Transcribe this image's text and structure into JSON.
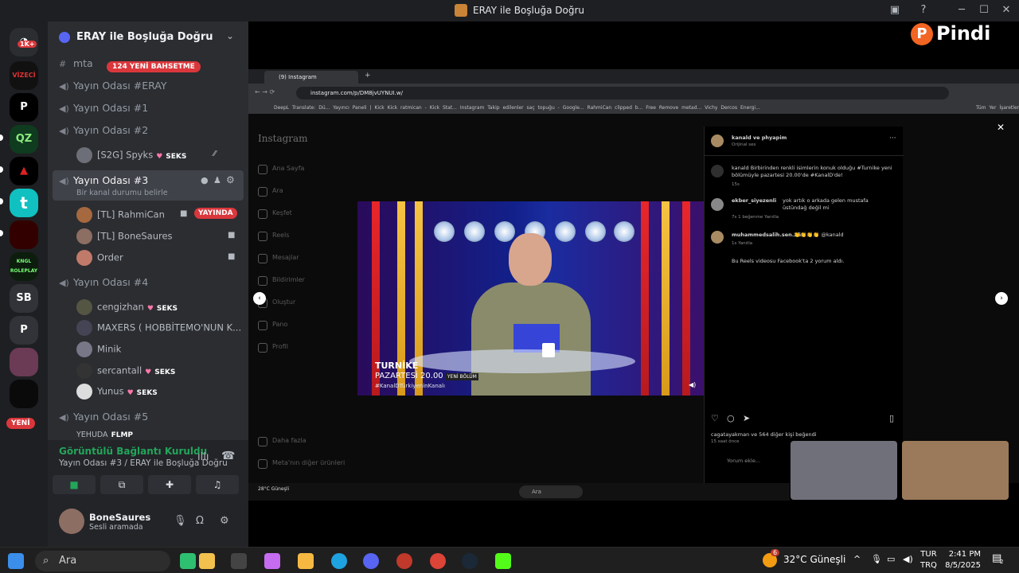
{
  "window": {
    "title": "ERAY ile Boşluğa Doğru",
    "minimize": "─",
    "maximize": "☐",
    "close": "✕"
  },
  "servers": [
    {
      "label": "",
      "badge": "1K+"
    },
    {
      "label": "VİZECİ"
    },
    {
      "label": "P"
    },
    {
      "label": "QZ"
    },
    {
      "label": "▲"
    },
    {
      "label": "t"
    },
    {
      "label": ""
    },
    {
      "label": "KNGL ROLEPLAY"
    },
    {
      "label": "SB"
    },
    {
      "label": "P"
    },
    {
      "label": ""
    },
    {
      "label": ""
    },
    {
      "label": "",
      "badge": "YENİ"
    }
  ],
  "guild": {
    "name": "ERAY ile Boşluğa Doğru",
    "chevron": "⌄"
  },
  "channels": {
    "mta": "mta",
    "mention_badge": "124 YENİ BAHSETME",
    "rooms": [
      {
        "name": "Yayın Odası #ERAY"
      },
      {
        "name": "Yayın Odası #1"
      },
      {
        "name": "Yayın Odası #2",
        "users": [
          {
            "name": "[S2G] Spyks",
            "tag": "SEKS"
          }
        ]
      },
      {
        "name": "Yayın Odası #3",
        "status": "Bir kanal durumu belirle",
        "users": [
          {
            "name": "[TL] RahmiCan",
            "live": "YAYINDA"
          },
          {
            "name": "[TL] BoneSaures"
          },
          {
            "name": "Order"
          }
        ]
      },
      {
        "name": "Yayın Odası #4",
        "users": [
          {
            "name": "cengizhan",
            "tag": "SEKS"
          },
          {
            "name": "MAXERS ( HOBBİTEMO'NUN K..."
          },
          {
            "name": "Minik"
          },
          {
            "name": "sercantall",
            "tag": "SEKS"
          },
          {
            "name": "Yunus",
            "tag": "SEKS"
          }
        ]
      },
      {
        "name": "Yayın Odası #5",
        "users": [
          {
            "name": "YEHUDA",
            "tag": "FLMP"
          }
        ]
      }
    ]
  },
  "voice_panel": {
    "status": "Görüntülü Bağlantı Kuruldu",
    "location": "Yayın Odası #3 / ERAY ile Boşluğa Doğru"
  },
  "user_panel": {
    "name": "BoneSaures",
    "status": "Sesli aramada"
  },
  "stream_overlay": {
    "brand": "Pindi",
    "brand_logo": "P"
  },
  "browser": {
    "tab": "(9) Instagram",
    "url": "instagram.com/p/DM8jvUYNUI.w/",
    "bookmarks": "DeepL Translate: Dü...   Yayıncı Paneli | Kick   Kick   ratmican - Kick Stat...   Instagram   Takip edilenler   saç topuğu - Google...   RahmiCan clipped b...   Free Remove metad...   Vichy Dercos Energi...",
    "all_bookmarks": "Tüm Yer İşaretleri"
  },
  "instagram": {
    "logo": "Instagram",
    "nav": [
      "Ana Sayfa",
      "Ara",
      "Keşfet",
      "Reels",
      "Mesajlar",
      "Bildirimler",
      "Oluştur",
      "Pano",
      "Profil"
    ],
    "more": "Daha fazla",
    "meta": "Meta'nın diğer ürünleri",
    "video": {
      "show": "TURNİKE",
      "day": "PAZARTESİ 20.00",
      "badge": "YENİ BÖLÜM",
      "channel": "#KanalDTürkiyeninKanalı"
    },
    "post": {
      "author": "kanald ve phyapim",
      "audio": "Orijinal ses",
      "caption": "kanald Birbirinden renkli isimlerin konuk olduğu #Turnike yeni bölümüyle pazartesi 20.00'de #KanalD'de!",
      "caption_time": "15s",
      "comments": [
        {
          "user": "ekber_siyezenli",
          "text": "yok artık o arkada gelen mustafa üstündağ değil mi",
          "meta": "7s  1 beğenme  Yanıtla"
        },
        {
          "user": "muhammedsalih.sen.35",
          "text": "👏👏👏👏 @kanald",
          "meta": "1s  Yanıtla"
        }
      ],
      "fb_note": "Bu Reels videosu Facebook'ta 2 yorum aldı.",
      "likes": "cagatayakman ve 564 diğer kişi beğendi",
      "likes_time": "15 saat önce",
      "comment_placeholder": "Yorum ekle..."
    }
  },
  "inner_taskbar": {
    "weather": "28°C Güneşli",
    "search": "Ara"
  },
  "taskbar": {
    "search": "Ara",
    "weather": "32°C  Güneşli",
    "weather_badge": "6",
    "lang": "TUR",
    "lang2": "TRQ",
    "time": "2:41 PM",
    "date": "8/5/2025",
    "notif": "2"
  },
  "colors": {
    "accent": "#5865f2",
    "live": "#da373c",
    "connected": "#23a55a",
    "pindi": "#f26522"
  }
}
